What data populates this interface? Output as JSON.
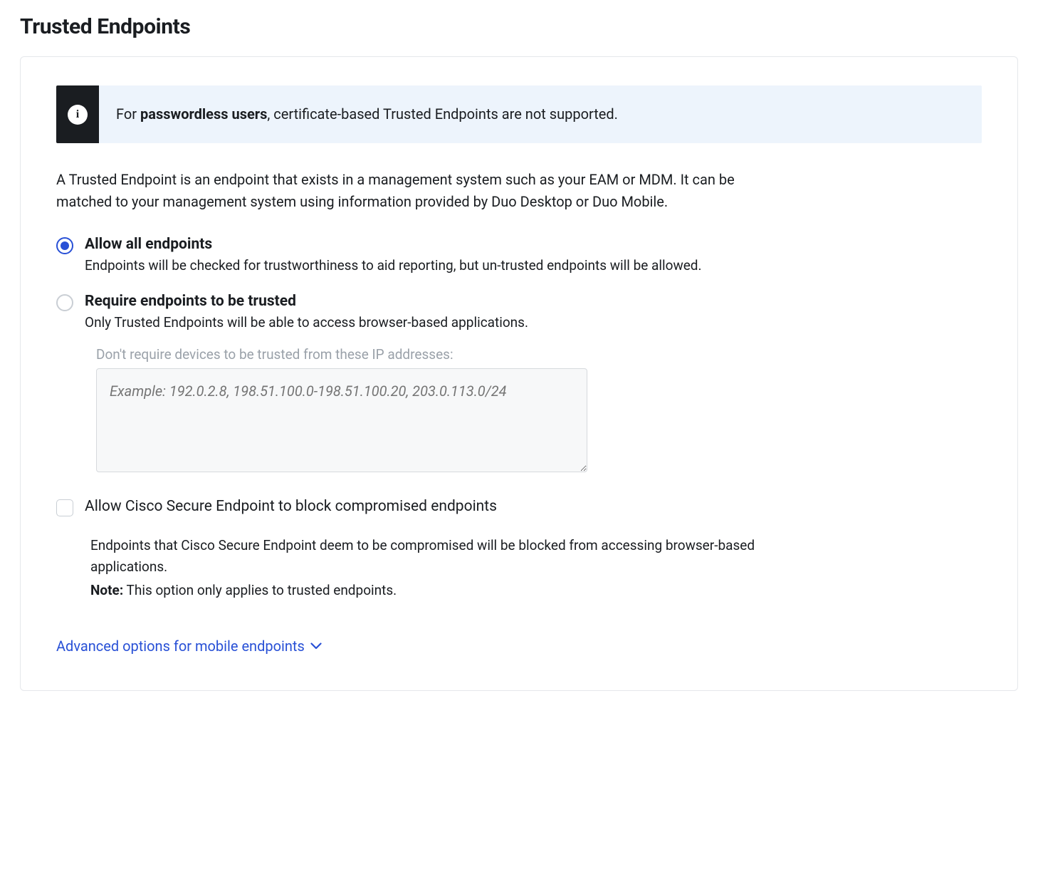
{
  "title": "Trusted Endpoints",
  "banner": {
    "prefix": "For ",
    "bold": "passwordless users",
    "suffix": ", certificate-based Trusted Endpoints are not supported."
  },
  "intro": "A Trusted Endpoint is an endpoint that exists in a management system such as your EAM or MDM. It can be matched to your management system using information provided by Duo Desktop or Duo Mobile.",
  "options": {
    "allow": {
      "label": "Allow all endpoints",
      "desc": "Endpoints will be checked for trustworthiness to aid reporting, but un-trusted endpoints will be allowed.",
      "selected": true
    },
    "require": {
      "label": "Require endpoints to be trusted",
      "desc": "Only Trusted Endpoints will be able to access browser-based applications.",
      "selected": false
    }
  },
  "ip_exception": {
    "label": "Don't require devices to be trusted from these IP addresses:",
    "placeholder": "Example: 192.0.2.8, 198.51.100.0-198.51.100.20, 203.0.113.0/24",
    "value": ""
  },
  "cisco_block": {
    "label": "Allow Cisco Secure Endpoint to block compromised endpoints",
    "checked": false,
    "desc": "Endpoints that Cisco Secure Endpoint deem to be compromised will be blocked from accessing browser-based applications.",
    "note_label": "Note:",
    "note_text": " This option only applies to trusted endpoints."
  },
  "advanced_link": "Advanced options for mobile endpoints"
}
